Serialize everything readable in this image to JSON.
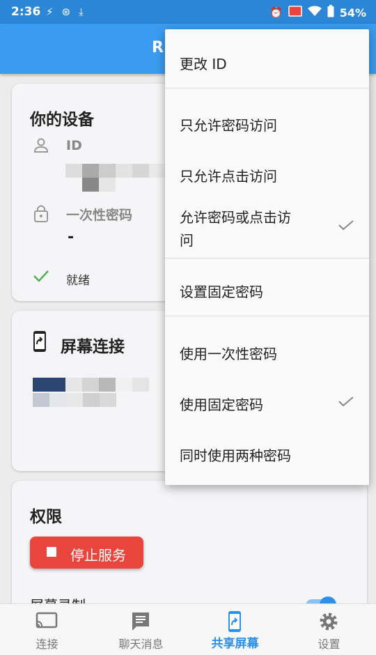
{
  "status_bar": {
    "time": "2:36",
    "battery": "54%"
  },
  "app_bar": {
    "title": "R"
  },
  "device_card": {
    "title": "你的设备",
    "id_label": "ID",
    "otp_label": "一次性密码",
    "otp_value": "-",
    "status": "就绪"
  },
  "screen_card": {
    "title": "屏幕连接"
  },
  "permissions_card": {
    "title": "权限",
    "stop_button": "停止服务",
    "screen_record_label": "屏幕录制"
  },
  "bottom_nav": {
    "items": [
      {
        "label": "连接",
        "icon": "cast-icon"
      },
      {
        "label": "聊天消息",
        "icon": "chat-icon"
      },
      {
        "label": "共享屏幕",
        "icon": "share-screen-icon"
      },
      {
        "label": "设置",
        "icon": "gear-icon"
      }
    ],
    "active_index": 2
  },
  "menu": {
    "items": [
      {
        "label": "更改 ID",
        "checked": false
      },
      {
        "label": "只允许密码访问",
        "checked": false
      },
      {
        "label": "只允许点击访问",
        "checked": false
      },
      {
        "label_line1": "允许密码或点击访",
        "label_line2": "问",
        "checked": true
      },
      {
        "label": "设置固定密码",
        "checked": false
      },
      {
        "label": "使用一次性密码",
        "checked": false
      },
      {
        "label": "使用固定密码",
        "checked": true
      },
      {
        "label": "同时使用两种密码",
        "checked": false
      }
    ]
  },
  "colors": {
    "status_bar": "#2b86d6",
    "app_bar": "#3a9cf0",
    "accent": "#2e8fe8",
    "stop_button": "#e8453c",
    "ready_check": "#4caf50"
  }
}
